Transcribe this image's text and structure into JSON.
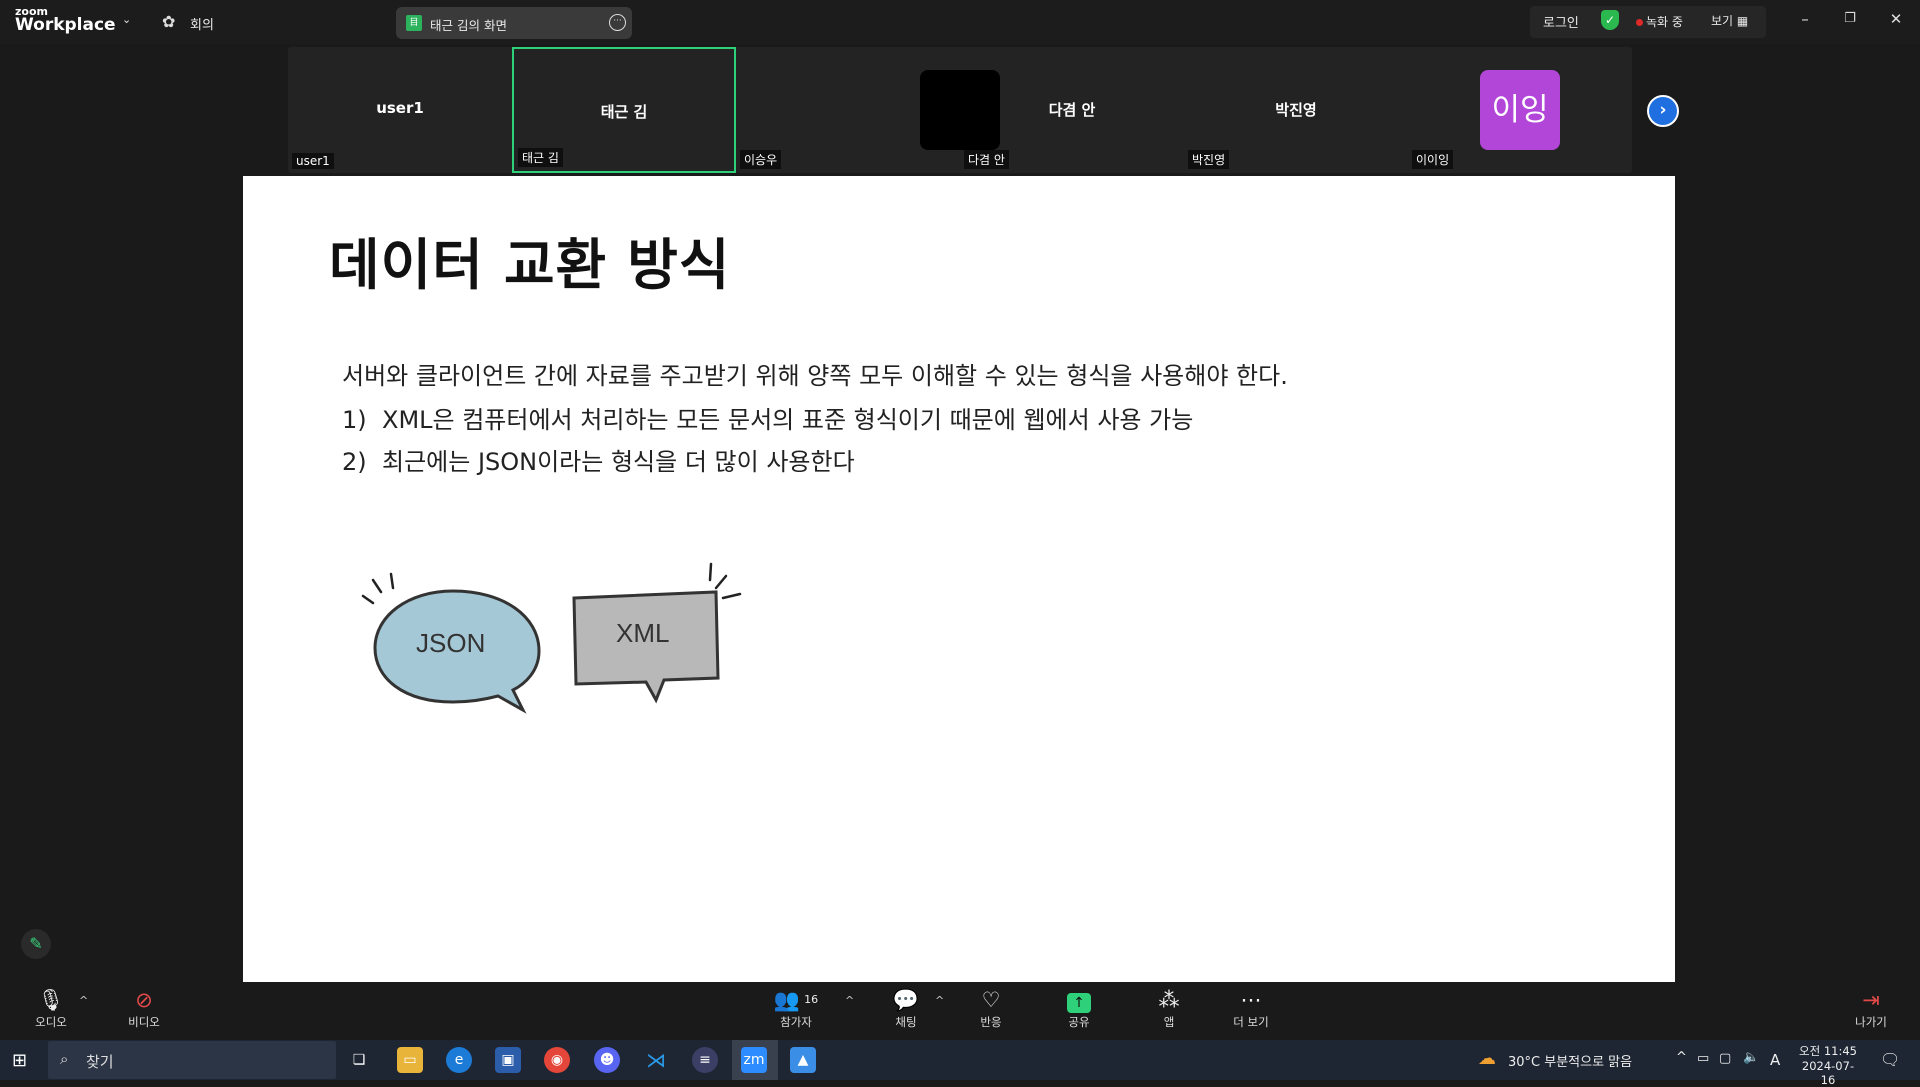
{
  "app": {
    "logo_small": "zoom",
    "logo_big": "Workplace",
    "meeting_label": "회의",
    "share_title": "태근 김의 화면",
    "login": "로그인",
    "recording": "녹화 중",
    "view": "보기"
  },
  "gallery": {
    "tiles": [
      {
        "center": "user1",
        "corner": "user1"
      },
      {
        "center": "태근 김",
        "corner": "태근 김"
      },
      {
        "center": "",
        "corner": "이승우"
      },
      {
        "center": "다겸 안",
        "corner": "다겸 안"
      },
      {
        "center": "박진영",
        "corner": "박진영"
      },
      {
        "center": "",
        "corner": "이이잉"
      }
    ],
    "purple_avatar": "이잉"
  },
  "slide": {
    "title": "데이터 교환 방식",
    "intro": "서버와 클라이언트 간에 자료를 주고받기 위해 양쪽 모두 이해할 수 있는 형식을 사용해야 한다.",
    "items": [
      {
        "num": "1)",
        "text": "XML은 컴퓨터에서 처리하는 모든 문서의 표준 형식이기 때문에 웹에서 사용 가능"
      },
      {
        "num": "2)",
        "text": "최근에는 JSON이라는 형식을 더 많이 사용한다"
      }
    ],
    "bubble_json": "JSON",
    "bubble_xml": "XML",
    "colors": {
      "json_bubble": "#a5c8d6",
      "xml_bubble": "#b8b8b8"
    }
  },
  "toolbar": {
    "audio": "오디오",
    "video": "비디오",
    "participants": "참가자",
    "participant_count": "16",
    "chat": "채팅",
    "reactions": "반응",
    "share": "공유",
    "apps": "앱",
    "more": "더 보기",
    "leave": "나가기"
  },
  "taskbar": {
    "search": "찾기",
    "weather": "30°C 부분적으로 맑음",
    "time": "오전 11:45",
    "date": "2024-07-16",
    "ime": "A"
  }
}
